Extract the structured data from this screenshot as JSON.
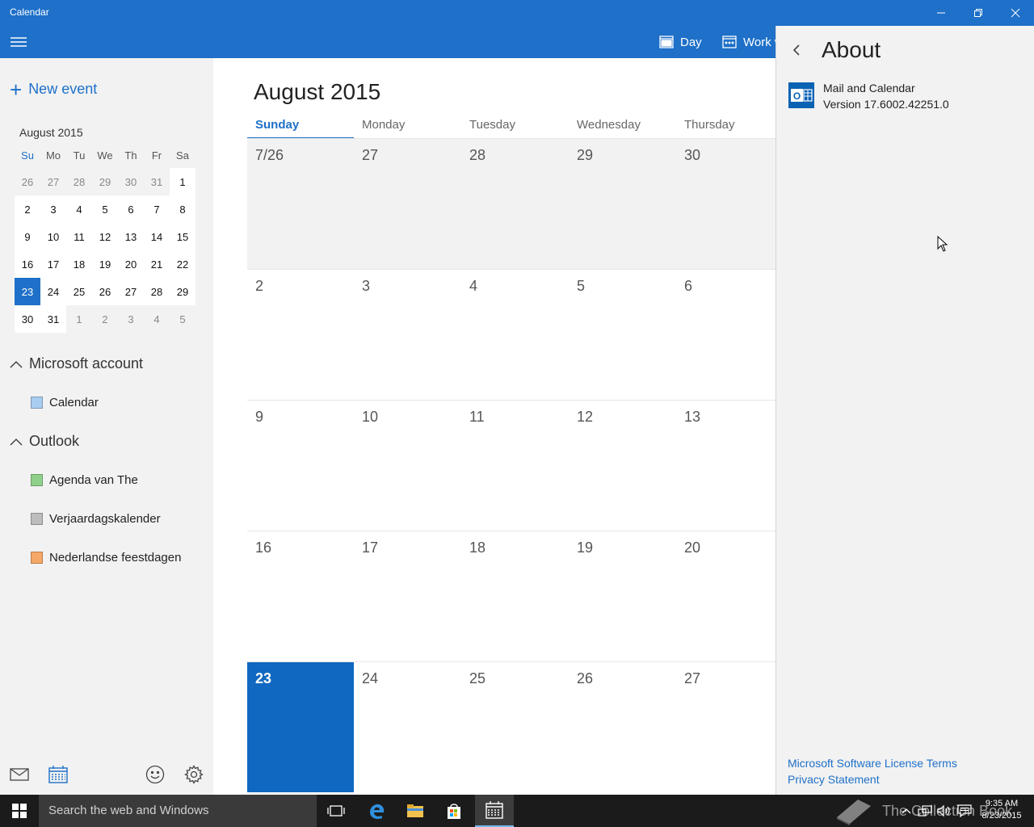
{
  "window": {
    "title": "Calendar"
  },
  "commandbar": {
    "day_label": "Day",
    "workweek_label": "Work w"
  },
  "sidebar": {
    "new_event_label": "New event",
    "mini_calendar": {
      "title": "August 2015",
      "day_names": [
        "Su",
        "Mo",
        "Tu",
        "We",
        "Th",
        "Fr",
        "Sa"
      ],
      "weeks": [
        [
          "26",
          "27",
          "28",
          "29",
          "30",
          "31",
          "1"
        ],
        [
          "2",
          "3",
          "4",
          "5",
          "6",
          "7",
          "8"
        ],
        [
          "9",
          "10",
          "11",
          "12",
          "13",
          "14",
          "15"
        ],
        [
          "16",
          "17",
          "18",
          "19",
          "20",
          "21",
          "22"
        ],
        [
          "23",
          "24",
          "25",
          "26",
          "27",
          "28",
          "29"
        ],
        [
          "30",
          "31",
          "1",
          "2",
          "3",
          "4",
          "5"
        ]
      ],
      "today": "23"
    },
    "groups": [
      {
        "name": "Microsoft account",
        "calendars": [
          {
            "name": "Calendar",
            "color": "#a8cdf0"
          }
        ]
      },
      {
        "name": "Outlook",
        "calendars": [
          {
            "name": "Agenda van The",
            "color": "#8fd18a"
          },
          {
            "name": "Verjaardagskalender",
            "color": "#bdbdbd"
          },
          {
            "name": "Nederlandse feestdagen",
            "color": "#f5a868"
          }
        ]
      }
    ]
  },
  "main": {
    "month_title": "August 2015",
    "day_headers": [
      "Sunday",
      "Monday",
      "Tuesday",
      "Wednesday",
      "Thursday"
    ],
    "active_day_header": "Sunday",
    "weeks": [
      [
        "7/26",
        "27",
        "28",
        "29",
        "30"
      ],
      [
        "2",
        "3",
        "4",
        "5",
        "6"
      ],
      [
        "9",
        "10",
        "11",
        "12",
        "13"
      ],
      [
        "16",
        "17",
        "18",
        "19",
        "20"
      ],
      [
        "23",
        "24",
        "25",
        "26",
        "27"
      ]
    ],
    "today": "23"
  },
  "about": {
    "heading": "About",
    "app_name": "Mail and Calendar",
    "version": "Version 17.6002.42251.0",
    "license_link": "Microsoft Software License Terms",
    "privacy_link": "Privacy Statement"
  },
  "taskbar": {
    "search_placeholder": "Search the web and Windows",
    "time": "9:35 AM",
    "date": "8/23/2015",
    "watermark": "The Collection Book"
  },
  "colors": {
    "accent": "#1e70c8",
    "today": "#1068c0",
    "pane": "#f2f2f2",
    "taskbar": "#1b1b1b"
  }
}
